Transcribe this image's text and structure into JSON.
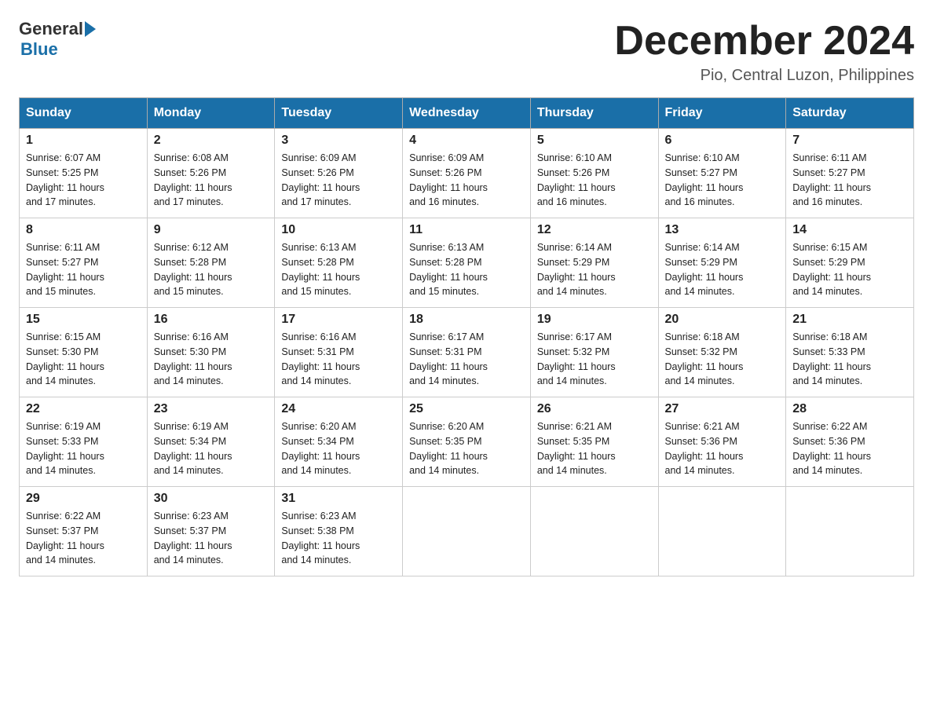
{
  "logo": {
    "general": "General",
    "blue": "Blue"
  },
  "title": "December 2024",
  "location": "Pio, Central Luzon, Philippines",
  "days_of_week": [
    "Sunday",
    "Monday",
    "Tuesday",
    "Wednesday",
    "Thursday",
    "Friday",
    "Saturday"
  ],
  "weeks": [
    [
      {
        "day": "1",
        "sunrise": "6:07 AM",
        "sunset": "5:25 PM",
        "daylight": "11 hours and 17 minutes."
      },
      {
        "day": "2",
        "sunrise": "6:08 AM",
        "sunset": "5:26 PM",
        "daylight": "11 hours and 17 minutes."
      },
      {
        "day": "3",
        "sunrise": "6:09 AM",
        "sunset": "5:26 PM",
        "daylight": "11 hours and 17 minutes."
      },
      {
        "day": "4",
        "sunrise": "6:09 AM",
        "sunset": "5:26 PM",
        "daylight": "11 hours and 16 minutes."
      },
      {
        "day": "5",
        "sunrise": "6:10 AM",
        "sunset": "5:26 PM",
        "daylight": "11 hours and 16 minutes."
      },
      {
        "day": "6",
        "sunrise": "6:10 AM",
        "sunset": "5:27 PM",
        "daylight": "11 hours and 16 minutes."
      },
      {
        "day": "7",
        "sunrise": "6:11 AM",
        "sunset": "5:27 PM",
        "daylight": "11 hours and 16 minutes."
      }
    ],
    [
      {
        "day": "8",
        "sunrise": "6:11 AM",
        "sunset": "5:27 PM",
        "daylight": "11 hours and 15 minutes."
      },
      {
        "day": "9",
        "sunrise": "6:12 AM",
        "sunset": "5:28 PM",
        "daylight": "11 hours and 15 minutes."
      },
      {
        "day": "10",
        "sunrise": "6:13 AM",
        "sunset": "5:28 PM",
        "daylight": "11 hours and 15 minutes."
      },
      {
        "day": "11",
        "sunrise": "6:13 AM",
        "sunset": "5:28 PM",
        "daylight": "11 hours and 15 minutes."
      },
      {
        "day": "12",
        "sunrise": "6:14 AM",
        "sunset": "5:29 PM",
        "daylight": "11 hours and 14 minutes."
      },
      {
        "day": "13",
        "sunrise": "6:14 AM",
        "sunset": "5:29 PM",
        "daylight": "11 hours and 14 minutes."
      },
      {
        "day": "14",
        "sunrise": "6:15 AM",
        "sunset": "5:29 PM",
        "daylight": "11 hours and 14 minutes."
      }
    ],
    [
      {
        "day": "15",
        "sunrise": "6:15 AM",
        "sunset": "5:30 PM",
        "daylight": "11 hours and 14 minutes."
      },
      {
        "day": "16",
        "sunrise": "6:16 AM",
        "sunset": "5:30 PM",
        "daylight": "11 hours and 14 minutes."
      },
      {
        "day": "17",
        "sunrise": "6:16 AM",
        "sunset": "5:31 PM",
        "daylight": "11 hours and 14 minutes."
      },
      {
        "day": "18",
        "sunrise": "6:17 AM",
        "sunset": "5:31 PM",
        "daylight": "11 hours and 14 minutes."
      },
      {
        "day": "19",
        "sunrise": "6:17 AM",
        "sunset": "5:32 PM",
        "daylight": "11 hours and 14 minutes."
      },
      {
        "day": "20",
        "sunrise": "6:18 AM",
        "sunset": "5:32 PM",
        "daylight": "11 hours and 14 minutes."
      },
      {
        "day": "21",
        "sunrise": "6:18 AM",
        "sunset": "5:33 PM",
        "daylight": "11 hours and 14 minutes."
      }
    ],
    [
      {
        "day": "22",
        "sunrise": "6:19 AM",
        "sunset": "5:33 PM",
        "daylight": "11 hours and 14 minutes."
      },
      {
        "day": "23",
        "sunrise": "6:19 AM",
        "sunset": "5:34 PM",
        "daylight": "11 hours and 14 minutes."
      },
      {
        "day": "24",
        "sunrise": "6:20 AM",
        "sunset": "5:34 PM",
        "daylight": "11 hours and 14 minutes."
      },
      {
        "day": "25",
        "sunrise": "6:20 AM",
        "sunset": "5:35 PM",
        "daylight": "11 hours and 14 minutes."
      },
      {
        "day": "26",
        "sunrise": "6:21 AM",
        "sunset": "5:35 PM",
        "daylight": "11 hours and 14 minutes."
      },
      {
        "day": "27",
        "sunrise": "6:21 AM",
        "sunset": "5:36 PM",
        "daylight": "11 hours and 14 minutes."
      },
      {
        "day": "28",
        "sunrise": "6:22 AM",
        "sunset": "5:36 PM",
        "daylight": "11 hours and 14 minutes."
      }
    ],
    [
      {
        "day": "29",
        "sunrise": "6:22 AM",
        "sunset": "5:37 PM",
        "daylight": "11 hours and 14 minutes."
      },
      {
        "day": "30",
        "sunrise": "6:23 AM",
        "sunset": "5:37 PM",
        "daylight": "11 hours and 14 minutes."
      },
      {
        "day": "31",
        "sunrise": "6:23 AM",
        "sunset": "5:38 PM",
        "daylight": "11 hours and 14 minutes."
      },
      null,
      null,
      null,
      null
    ]
  ]
}
